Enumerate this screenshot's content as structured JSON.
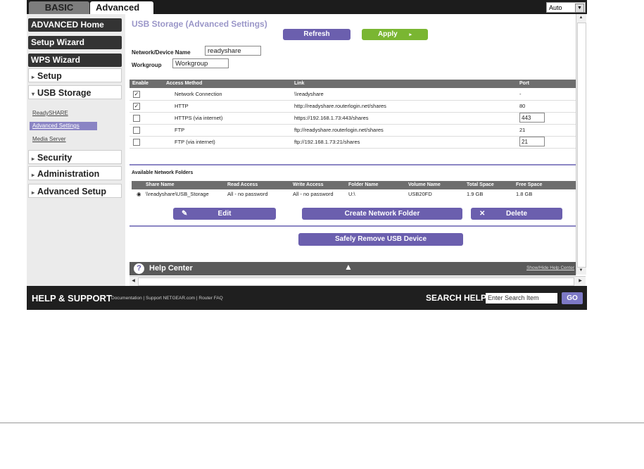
{
  "tabs": {
    "basic": "BASIC",
    "advanced": "Advanced"
  },
  "language": "Auto",
  "sidebar": {
    "advanced_home": "ADVANCED Home",
    "setup_wizard": "Setup Wizard",
    "wps_wizard": "WPS Wizard",
    "setup": "Setup",
    "usb_storage": "USB Storage",
    "sub_readyshare": "ReadySHARE",
    "sub_advanced_settings": "Advanced Settings",
    "sub_media_server": "Media Server",
    "security": "Security",
    "administration": "Administration",
    "advanced_setup": "Advanced Setup"
  },
  "page": {
    "title": "USB Storage (Advanced Settings)",
    "refresh": "Refresh",
    "apply": "Apply",
    "network_device_name_label": "Network/Device Name",
    "network_device_name": "readyshare",
    "workgroup_label": "Workgroup",
    "workgroup": "Workgroup"
  },
  "access_table": {
    "headers": [
      "Enable",
      "Access Method",
      "Link",
      "Port"
    ],
    "rows": [
      {
        "checked": true,
        "method": "Network Connection",
        "link": "\\\\readyshare",
        "port": "-"
      },
      {
        "checked": true,
        "method": "HTTP",
        "link": "http://readyshare.routerlogin.net/shares",
        "port": "80"
      },
      {
        "checked": false,
        "method": "HTTPS (via internet)",
        "link": "https://192.168.1.73:443/shares",
        "port": "443"
      },
      {
        "checked": false,
        "method": "FTP",
        "link": "ftp://readyshare.routerlogin.net/shares",
        "port": "21"
      },
      {
        "checked": false,
        "method": "FTP (via internet)",
        "link": "ftp://192.168.1.73:21/shares",
        "port": "21"
      }
    ]
  },
  "folders": {
    "section_label": "Available Network Folders",
    "headers": [
      "Share Name",
      "Read Access",
      "Write Access",
      "Folder Name",
      "Volume Name",
      "Total Space",
      "Free Space"
    ],
    "rows": [
      {
        "share": "\\\\readyshare\\USB_Storage",
        "read": "All - no password",
        "write": "All - no password",
        "folder": "U:\\",
        "volume": "USB20FD",
        "total": "1.9 GB",
        "free": "1.8 GB"
      }
    ],
    "edit": "Edit",
    "create": "Create Network Folder",
    "delete": "Delete",
    "safely_remove": "Safely Remove USB Device"
  },
  "help": {
    "title": "Help Center",
    "toggle": "Show/Hide Help Center"
  },
  "footer": {
    "help_support": "HELP & SUPPORT",
    "links": "Documentation | Support NETGEAR.com | Router FAQ",
    "search_help": "SEARCH HELP",
    "search_placeholder": "Enter Search Item",
    "go": "GO"
  },
  "colors": {
    "accent_purple": "#6b5fae",
    "apply_green": "#7ab632",
    "title_lavender": "#9a96c8"
  }
}
